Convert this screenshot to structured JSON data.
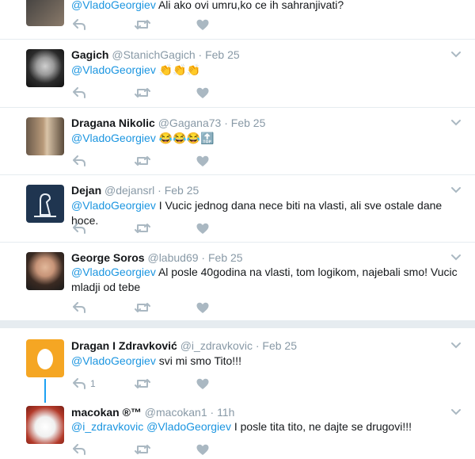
{
  "tweets": [
    {
      "name": "",
      "handle": "",
      "time": "",
      "mention": "@VladoGeorgiev",
      "text": " Ali ako ovi umru,ko ce ih sahranjivati?",
      "reply_count": ""
    },
    {
      "name": "Gagich",
      "handle": "@StanichGagich",
      "dot": "·",
      "time": "Feb 25",
      "mention": "@VladoGeorgiev",
      "text": " 👏👏👏",
      "reply_count": ""
    },
    {
      "name": "Dragana Nikolic",
      "handle": "@Gagana73",
      "dot": "·",
      "time": "Feb 25",
      "mention": "@VladoGeorgiev",
      "text": " 😂😂😂🔝",
      "reply_count": ""
    },
    {
      "name": "Dejan",
      "handle": "@dejansrl",
      "dot": "·",
      "time": "Feb 25",
      "mention": "@VladoGeorgiev",
      "text": " I Vucic jednog dana nece biti na vlasti, ali sve ostale dane hoce.",
      "reply_count": ""
    },
    {
      "name": "George Soros",
      "handle": "@labud69",
      "dot": "·",
      "time": "Feb 25",
      "mention": "@VladoGeorgiev",
      "text": " Al posle 40godina na vlasti, tom logikom, najebali smo! Vucic mladji od tebe",
      "reply_count": ""
    },
    {
      "name": "Dragan I Zdravković",
      "handle": "@i_zdravkovic",
      "dot": "·",
      "time": "Feb 25",
      "mention": "@VladoGeorgiev",
      "text": " svi mi smo Tito!!!",
      "reply_count": "1"
    },
    {
      "name": "macokan ®™",
      "handle": "@macokan1",
      "dot": "·",
      "time": "11h",
      "mention": "@i_zdravkovic @VladoGeorgiev",
      "text": " I posle tita tito, ne dajte se drugovi!!!",
      "reply_count": ""
    }
  ],
  "icons": {
    "reply": "reply-icon",
    "retweet": "retweet-icon",
    "like": "heart-icon",
    "more": "chevron-down-icon"
  },
  "colors": {
    "link": "#1b95e0",
    "muted": "#8899a6",
    "icon": "#aab8c2",
    "thread": "#1da1f2"
  }
}
